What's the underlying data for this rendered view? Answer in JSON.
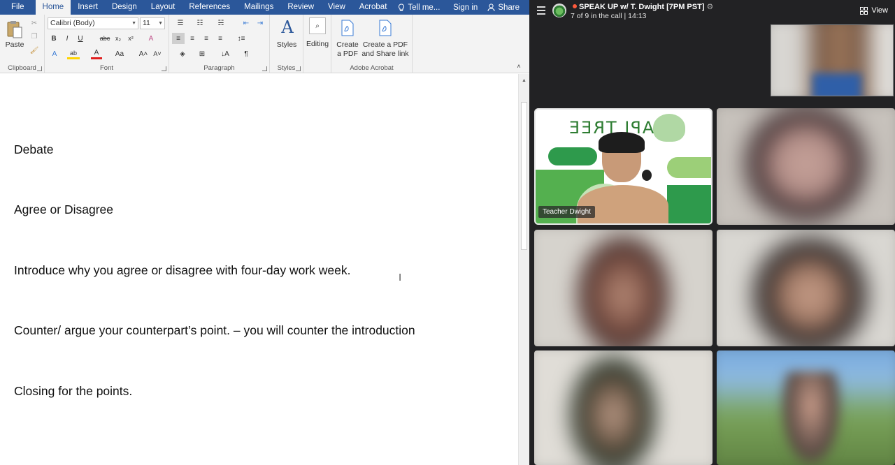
{
  "word": {
    "tabs": [
      "File",
      "Home",
      "Insert",
      "Design",
      "Layout",
      "References",
      "Mailings",
      "Review",
      "View",
      "Acrobat"
    ],
    "active_tab": "Home",
    "tell_me": "Tell me...",
    "sign_in": "Sign in",
    "share": "Share",
    "ribbon": {
      "clipboard": {
        "label": "Clipboard",
        "paste": "Paste"
      },
      "font": {
        "label": "Font",
        "name": "Calibri (Body)",
        "size": "11"
      },
      "paragraph": {
        "label": "Paragraph"
      },
      "styles": {
        "label": "Styles",
        "button": "Styles"
      },
      "editing": {
        "button": "Editing"
      },
      "acrobat": {
        "label": "Adobe Acrobat",
        "create_pdf_1": "Create",
        "create_pdf_2": "a PDF",
        "share_link_1": "Create a PDF",
        "share_link_2": "and Share link"
      }
    },
    "document": {
      "lines": [
        "Debate",
        "Agree or Disagree",
        "Introduce why you agree or disagree with four-day work week.",
        "Counter/ argue your counterpart’s point. – you will counter the introduction",
        "Closing for the points."
      ]
    }
  },
  "meeting": {
    "title": "SPEAK UP w/ T. Dwight [7PM PST]",
    "subtitle": "7 of 9 in the call | 14:13",
    "view_label": "View",
    "speaker_name": "Teacher Dwight",
    "speaker_logo_text": "API TREE"
  }
}
